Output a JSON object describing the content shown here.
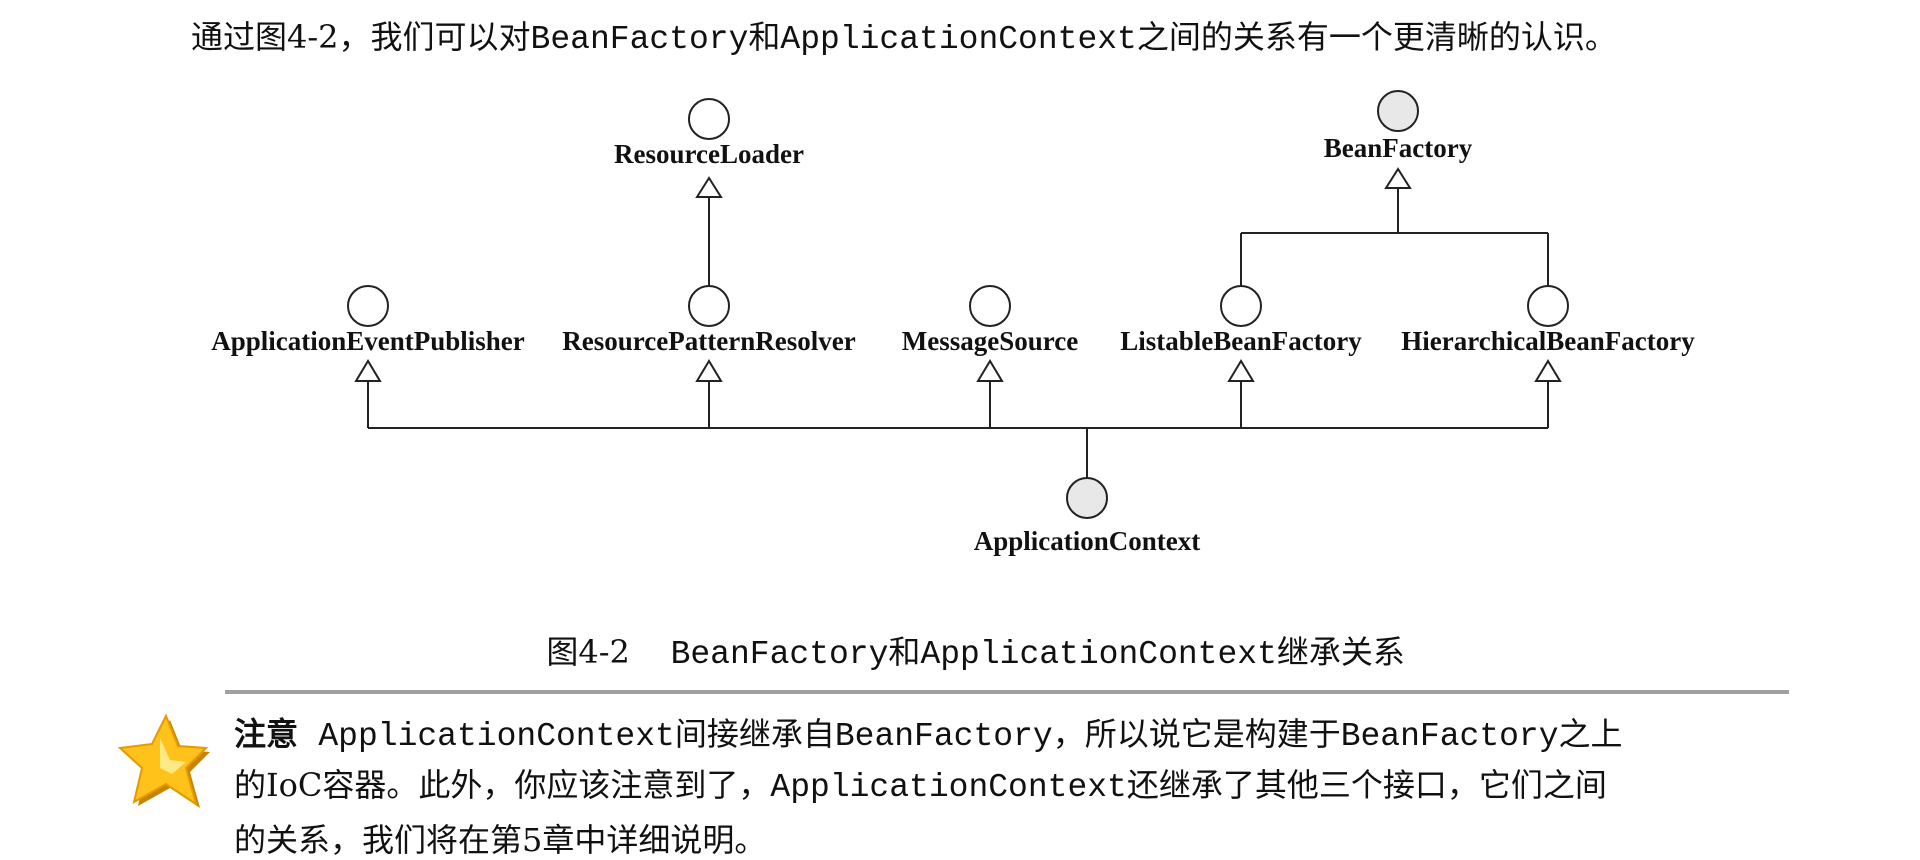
{
  "intro": [
    {
      "text": "通过图4-2，我们可以对",
      "mono": false
    },
    {
      "text": "BeanFactory",
      "mono": true
    },
    {
      "text": "和",
      "mono": false
    },
    {
      "text": "ApplicationContext",
      "mono": true
    },
    {
      "text": "之间的关系有一个更清晰的认识。",
      "mono": false
    }
  ],
  "diagram": {
    "nodes": {
      "resource_loader": "ResourceLoader",
      "bean_factory": "BeanFactory",
      "application_event_publisher": "ApplicationEventPublisher",
      "resource_pattern_resolver": "ResourcePatternResolver",
      "message_source": "MessageSource",
      "listable_bean_factory": "ListableBeanFactory",
      "hierarchical_bean_factory": "HierarchicalBeanFactory",
      "application_context": "ApplicationContext"
    },
    "highlight_fill": "#e8e8e8"
  },
  "caption": {
    "number": "图4-2",
    "segments": [
      {
        "text": "BeanFactory",
        "mono": true
      },
      {
        "text": "和",
        "mono": false
      },
      {
        "text": "ApplicationContext",
        "mono": true
      },
      {
        "text": "继承关系",
        "mono": false
      }
    ]
  },
  "note": {
    "icon": "star-icon",
    "lines": [
      [
        {
          "text": "注意",
          "mono": false,
          "bold": true
        },
        {
          "text": "  ",
          "mono": false
        },
        {
          "text": "ApplicationContext",
          "mono": true
        },
        {
          "text": "间接继承自",
          "mono": false
        },
        {
          "text": "BeanFactory",
          "mono": true
        },
        {
          "text": "，所以说它是构建于",
          "mono": false
        },
        {
          "text": "BeanFactory",
          "mono": true
        },
        {
          "text": "之上",
          "mono": false
        }
      ],
      [
        {
          "text": "的IoC容器。此外，你应该注意到了，",
          "mono": false
        },
        {
          "text": "ApplicationContext",
          "mono": true
        },
        {
          "text": "还继承了其他三个接口，它们之间",
          "mono": false
        }
      ],
      [
        {
          "text": "的关系，我们将在第5章中详细说明。",
          "mono": false
        }
      ]
    ]
  }
}
